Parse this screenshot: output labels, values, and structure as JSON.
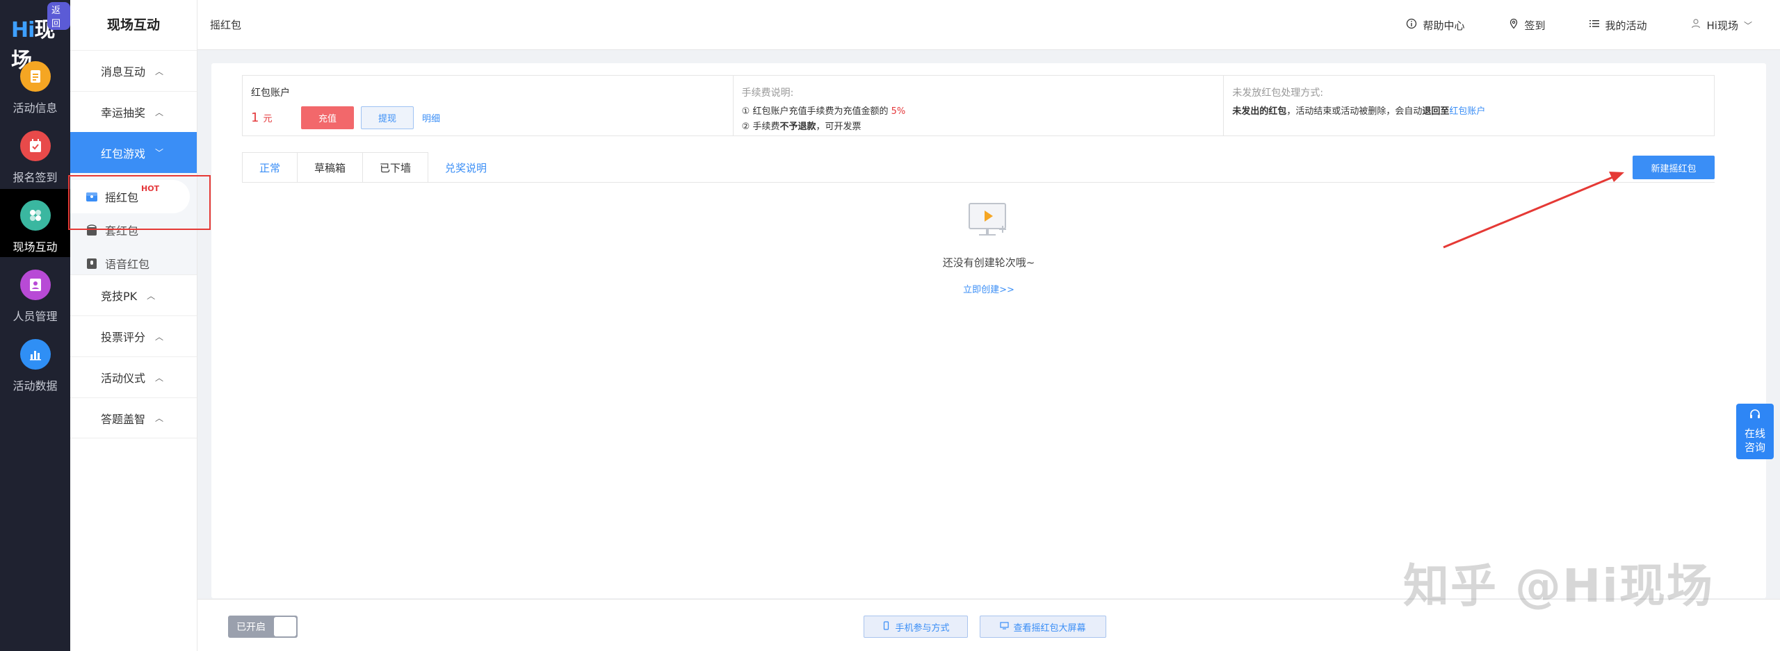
{
  "rail": {
    "logo": "Hi现场",
    "back_badge": "返回",
    "items": [
      {
        "label": "活动信息",
        "icon": "document-icon",
        "color": "#f5a623"
      },
      {
        "label": "报名签到",
        "icon": "checkin-icon",
        "color": "#e84a4a"
      },
      {
        "label": "现场互动",
        "icon": "interact-icon",
        "color": "#3ab7a0"
      },
      {
        "label": "人员管理",
        "icon": "person-icon",
        "color": "#b84ad6"
      },
      {
        "label": "活动数据",
        "icon": "chart-icon",
        "color": "#2f8ff5"
      }
    ]
  },
  "sidebar": {
    "title": "现场互动",
    "groups": [
      {
        "label": "消息互动"
      },
      {
        "label": "幸运抽奖"
      },
      {
        "label": "红包游戏"
      },
      {
        "label": "竞技PK"
      },
      {
        "label": "投票评分"
      },
      {
        "label": "活动仪式"
      },
      {
        "label": "答题盖智"
      }
    ],
    "sub_items": [
      {
        "label": "摇红包",
        "badge": "HOT"
      },
      {
        "label": "套红包"
      },
      {
        "label": "语音红包"
      }
    ]
  },
  "header": {
    "breadcrumb": "摇红包",
    "help": "帮助中心",
    "signin": "签到",
    "my_activity": "我的活动",
    "user": "Hi现场"
  },
  "account": {
    "title": "红包账户",
    "amount": "1",
    "unit": "元",
    "recharge": "充值",
    "withdraw": "提现",
    "detail": "明细"
  },
  "fee": {
    "title": "手续费说明:",
    "line1_a": "① 红包账户充值手续费为充值金额的",
    "line1_b": "5%",
    "line2_a": "② 手续费",
    "line2_b": "不予退款",
    "line2_c": "，可开发票"
  },
  "unsent": {
    "title": "未发放红包处理方式:",
    "text_a": "未发出的红包",
    "text_b": "，活动结束或活动被删除，会自动",
    "text_c": "退回至",
    "text_d": "红包账户"
  },
  "tabs": [
    "正常",
    "草稿箱",
    "已下墙"
  ],
  "tab_link": "兑奖说明",
  "new_button": "新建摇红包",
  "empty": {
    "text": "还没有创建轮次哦~",
    "link": "立即创建>>"
  },
  "bottom": {
    "toggle": "已开启",
    "mobile": "手机参与方式",
    "screen": "查看摇红包大屏幕"
  },
  "consult": {
    "line1": "在线",
    "line2": "咨询"
  },
  "watermark": "知乎 @Hi现场",
  "colors": {
    "primary": "#3a8ef6",
    "danger": "#e4393c",
    "rail_bg": "#1f2230"
  }
}
